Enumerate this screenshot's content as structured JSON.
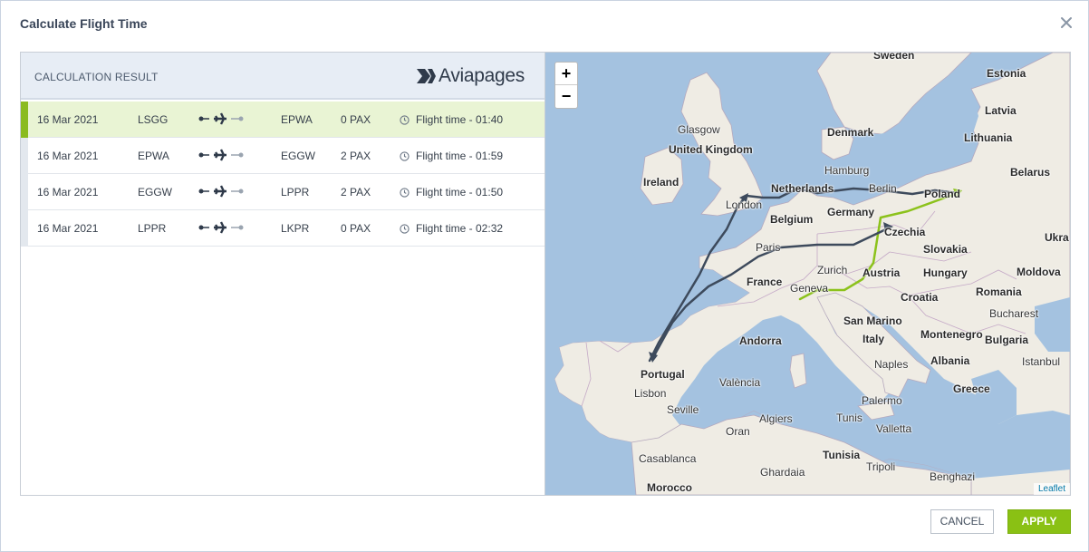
{
  "dialog": {
    "title": "Calculate Flight Time",
    "close_icon": "close-icon"
  },
  "result": {
    "heading": "CALCULATION RESULT",
    "logo_text": "Aviapages",
    "rows": [
      {
        "date": "16 Mar 2021",
        "from": "LSGG",
        "to": "EPWA",
        "pax": "0 PAX",
        "time": "Flight time - 01:40",
        "active": true
      },
      {
        "date": "16 Mar 2021",
        "from": "EPWA",
        "to": "EGGW",
        "pax": "2 PAX",
        "time": "Flight time - 01:59",
        "active": false
      },
      {
        "date": "16 Mar 2021",
        "from": "EGGW",
        "to": "LPPR",
        "pax": "2 PAX",
        "time": "Flight time - 01:50",
        "active": false
      },
      {
        "date": "16 Mar 2021",
        "from": "LPPR",
        "to": "LKPR",
        "pax": "0 PAX",
        "time": "Flight time - 02:32",
        "active": false
      }
    ]
  },
  "map": {
    "zoom_in": "+",
    "zoom_out": "−",
    "attribution": "Leaflet",
    "labels": {
      "sweden": "Sweden",
      "estonia": "Estonia",
      "latvia": "Latvia",
      "lithuania": "Lithuania",
      "belarus": "Belarus",
      "denmark": "Denmark",
      "glasgow": "Glasgow",
      "united_kingdom": "United Kingdom",
      "ireland": "Ireland",
      "hamburg": "Hamburg",
      "netherlands": "Netherlands",
      "berlin": "Berlin",
      "poland": "Poland",
      "london": "London",
      "belgium": "Belgium",
      "germany": "Germany",
      "czechia": "Czechia",
      "ukraine": "Ukra",
      "paris": "Paris",
      "slovakia": "Slovakia",
      "moldova": "Moldova",
      "zurich": "Zurich",
      "austria": "Austria",
      "hungary": "Hungary",
      "france": "France",
      "geneva": "Geneva",
      "croatia": "Croatia",
      "romania": "Romania",
      "bucharest": "Bucharest",
      "san_marino": "San Marino",
      "montenegro": "Montenegro",
      "bulgaria": "Bulgaria",
      "andorra": "Andorra",
      "italy": "Italy",
      "portugal": "Portugal",
      "valencia": "València",
      "naples": "Naples",
      "albania": "Albania",
      "istanbul": "Istanbul",
      "lisbon": "Lisbon",
      "greece": "Greece",
      "seville": "Seville",
      "palermo": "Palermo",
      "algiers": "Algiers",
      "tunis": "Tunis",
      "oran": "Oran",
      "valletta": "Valletta",
      "casablanca": "Casablanca",
      "tunisia": "Tunisia",
      "tripoli": "Tripoli",
      "ghardaia": "Ghardaia",
      "benghazi": "Benghazi",
      "morocco": "Morocco"
    }
  },
  "footer": {
    "cancel_label": "CANCEL",
    "apply_label": "APPLY"
  },
  "colors": {
    "accent": "#8ac114",
    "active_row": "#e9f4d4",
    "route_active": "#8cc21c",
    "route": "#3d4a5c",
    "water": "#a4c2e0",
    "land": "#efece4"
  }
}
